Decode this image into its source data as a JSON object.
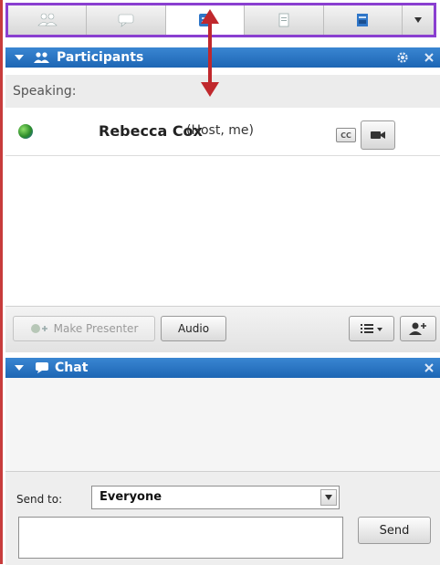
{
  "toolbar": {
    "buttons": [
      {
        "icon": "participants-icon"
      },
      {
        "icon": "chat-icon"
      },
      {
        "icon": "notes-icon",
        "active": true
      },
      {
        "icon": "document-icon"
      },
      {
        "icon": "presentation-icon"
      }
    ],
    "dropdown_icon": "chevron-down-icon"
  },
  "participants": {
    "header_title": "Participants",
    "speaking_label": "Speaking:",
    "people": [
      {
        "name": "Rebecca Cox",
        "role": "(Host, me)"
      }
    ],
    "cc_label": "CC",
    "make_presenter_label": "Make Presenter",
    "audio_label": "Audio"
  },
  "chat": {
    "header_title": "Chat",
    "send_to_label": "Send to:",
    "send_to_value": "Everyone",
    "send_label": "Send",
    "message_value": ""
  },
  "colors": {
    "header_blue": "#1d66b4",
    "toolbar_highlight": "#8a3fd0",
    "annotation_arrow": "#c0282d"
  }
}
